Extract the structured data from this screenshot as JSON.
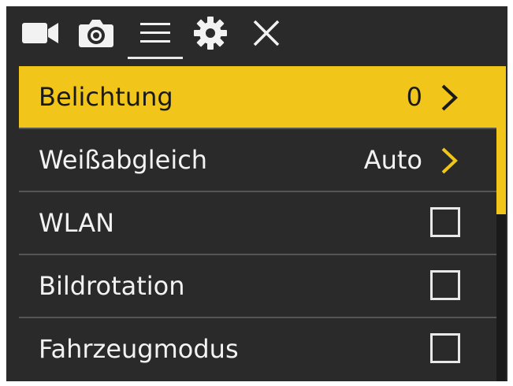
{
  "tabs": [
    {
      "icon": "video-camera-icon",
      "label": ""
    },
    {
      "icon": "photo-camera-icon",
      "label": ""
    },
    {
      "icon": "menu-icon",
      "label": ""
    },
    {
      "icon": "gear-icon",
      "label": ""
    },
    {
      "icon": "close-icon",
      "label": ""
    }
  ],
  "active_tab": "menu-icon",
  "menu": {
    "items": [
      {
        "label": "Belichtung",
        "value": "0",
        "control": "chevron",
        "selected": true
      },
      {
        "label": "Weißabgleich",
        "value": "Auto",
        "control": "chevron",
        "selected": false
      },
      {
        "label": "WLAN",
        "value": "",
        "control": "checkbox",
        "checked": false,
        "selected": false
      },
      {
        "label": "Bildrotation",
        "value": "",
        "control": "checkbox",
        "checked": false,
        "selected": false
      },
      {
        "label": "Fahrzeugmodus",
        "value": "",
        "control": "checkbox",
        "checked": false,
        "selected": false
      }
    ]
  },
  "colors": {
    "background": "#2a2a2a",
    "accent": "#f1c519",
    "text": "#f2f2f2",
    "selected_text": "#1a1a1a"
  }
}
